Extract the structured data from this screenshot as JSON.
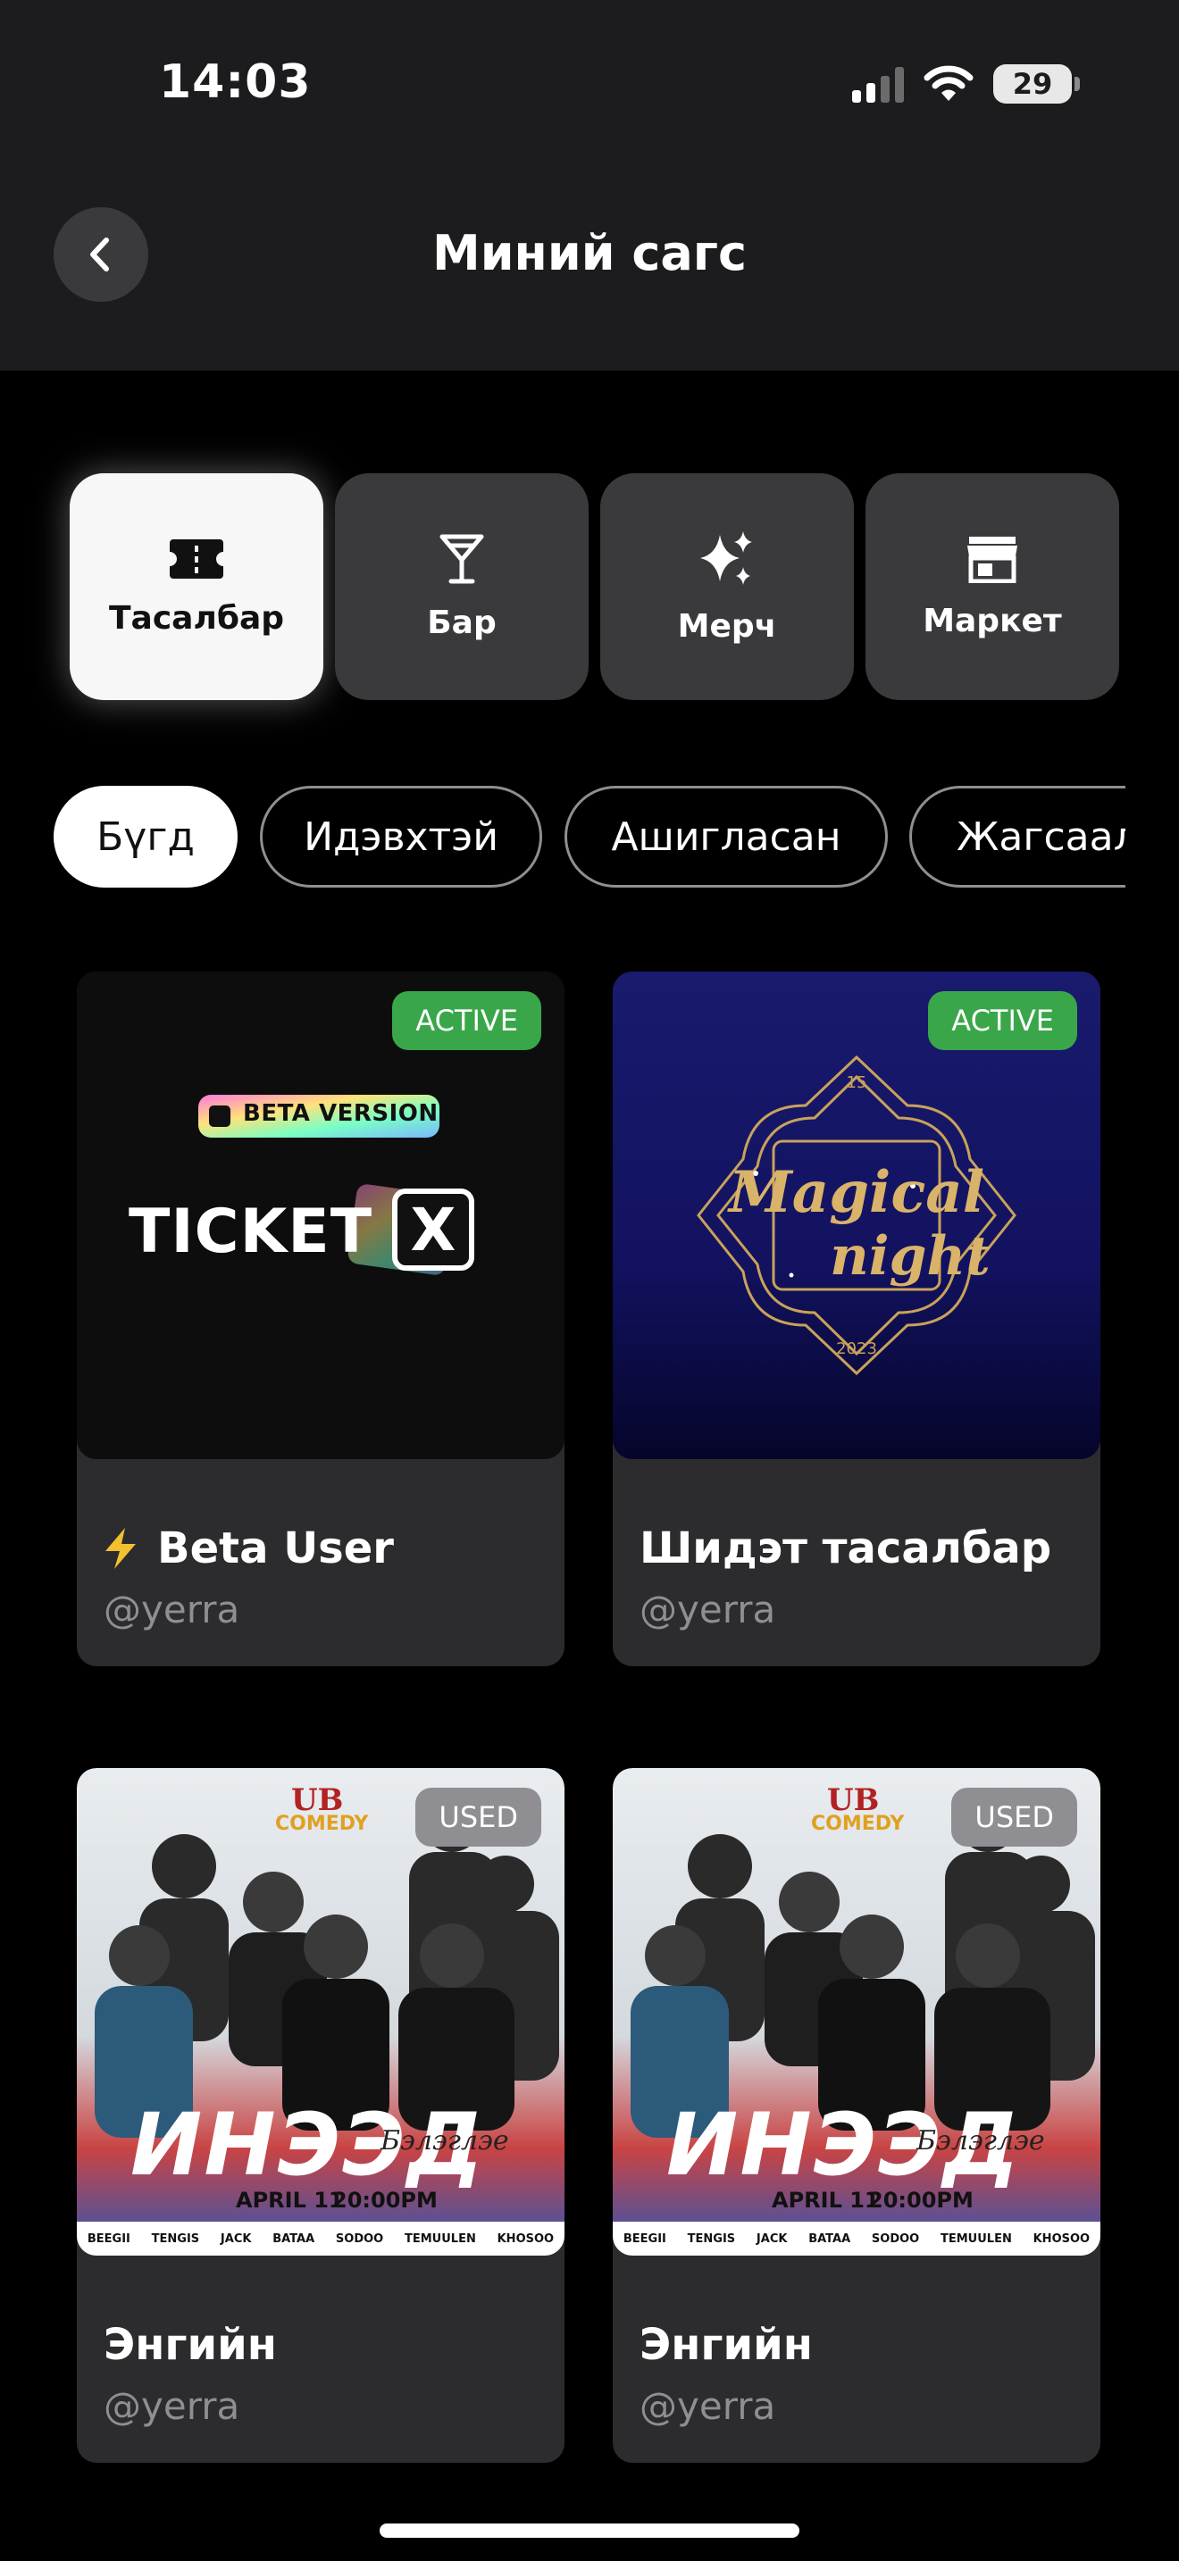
{
  "status_bar": {
    "time": "14:03",
    "battery": "29"
  },
  "header": {
    "title": "Миний сагс",
    "back_icon": "chevron-left-icon"
  },
  "categories": [
    {
      "label": "Тасалбар",
      "icon": "ticket-icon",
      "active": true
    },
    {
      "label": "Бар",
      "icon": "cocktail-icon",
      "active": false
    },
    {
      "label": "Мерч",
      "icon": "sparkles-icon",
      "active": false
    },
    {
      "label": "Маркет",
      "icon": "store-icon",
      "active": false
    }
  ],
  "filters": [
    {
      "label": "Бүгд",
      "active": true
    },
    {
      "label": "Идэвхтэй",
      "active": false
    },
    {
      "label": "Ашигласан",
      "active": false
    },
    {
      "label": "Жагсаал",
      "active": false
    }
  ],
  "cards": [
    {
      "badge": "ACTIVE",
      "title": "Beta User",
      "title_icon": "lightning-icon",
      "user": "@yerra",
      "image": {
        "beta_label": "BETA VERSION",
        "logo_text": "TICKET",
        "logo_mark": "X"
      }
    },
    {
      "badge": "ACTIVE",
      "title": "Шидэт тасалбар",
      "user": "@yerra",
      "image": {
        "text_line1": "Magical",
        "text_line2": "night",
        "top_mark": "15",
        "bottom_mark": "2023"
      }
    },
    {
      "badge": "USED",
      "title": "Энгийн",
      "user": "@yerra",
      "image": {
        "brand_top": "UB",
        "brand_sub": "COMEDY",
        "headline": "ИНЭЭД",
        "script": "Бэлэглэе",
        "date": "APRIL 11",
        "time": "20:00PM",
        "names": [
          "BEEGII",
          "TENGIS",
          "JACK",
          "BATAA",
          "SODOO",
          "TEMUULEN",
          "KHOSOO"
        ]
      }
    },
    {
      "badge": "USED",
      "title": "Энгийн",
      "user": "@yerra",
      "image": {
        "brand_top": "UB",
        "brand_sub": "COMEDY",
        "headline": "ИНЭЭД",
        "script": "Бэлэглэе",
        "date": "APRIL 11",
        "time": "20:00PM",
        "names": [
          "BEEGII",
          "TENGIS",
          "JACK",
          "BATAA",
          "SODOO",
          "TEMUULEN",
          "KHOSOO"
        ]
      }
    }
  ],
  "colors": {
    "active_badge": "#3aa64a",
    "used_badge": "#8e8e93",
    "tab_bg": "#3a3a3c"
  }
}
